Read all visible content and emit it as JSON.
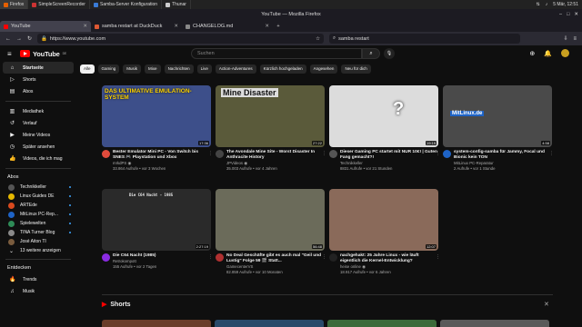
{
  "taskbar": {
    "tasks": [
      "Firefox",
      "SimpleScreenRecorder",
      "Samba-Server Konfiguration",
      "Thunar"
    ],
    "clock": "5 Mär, 12:51"
  },
  "window": {
    "title": "YouTube — Mozilla Firefox"
  },
  "tabs": [
    {
      "label": "YouTube",
      "active": true
    },
    {
      "label": "samba restart at DuckDuck",
      "active": false
    },
    {
      "label": "CHANGELOG.md",
      "active": false
    }
  ],
  "nav": {
    "url": "https://www.youtube.com",
    "search_value": "samba restart"
  },
  "yt": {
    "logo_text": "YouTube",
    "region": "DE",
    "search_placeholder": "Suchen",
    "sidebar_main": [
      {
        "label": "Startseite",
        "icon": "home-icon",
        "active": true
      },
      {
        "label": "Shorts",
        "icon": "shorts-icon"
      },
      {
        "label": "Abos",
        "icon": "subscriptions-icon"
      }
    ],
    "sidebar_you": [
      {
        "label": "Mediathek",
        "icon": "library-icon"
      },
      {
        "label": "Verlauf",
        "icon": "history-icon"
      },
      {
        "label": "Meine Videos",
        "icon": "my-videos-icon"
      },
      {
        "label": "Später ansehen",
        "icon": "watch-later-icon"
      },
      {
        "label": "Videos, die ich mag",
        "icon": "like-icon"
      }
    ],
    "abos_heading": "Abos",
    "abos": [
      {
        "label": "Technikkeller",
        "color": "#555",
        "dot": true
      },
      {
        "label": "Linux Guides DE",
        "color": "#e6b800",
        "dot": true
      },
      {
        "label": "ARTEde",
        "color": "#d94a1e",
        "dot": true
      },
      {
        "label": "MitLinux PC-Rep...",
        "color": "#1e63c6",
        "dot": true
      },
      {
        "label": "Spielewelten",
        "color": "#2e8b57",
        "dot": true
      },
      {
        "label": "TINA Turner Blog",
        "color": "#8a8a8a",
        "dot": true
      },
      {
        "label": "José Aiton TI",
        "color": "#7a5c3e",
        "dot": false
      },
      {
        "label": "13 weitere anzeigen",
        "icon": "chevron-down-icon"
      }
    ],
    "entdecken_heading": "Entdecken",
    "entdecken": [
      {
        "label": "Trends",
        "icon": "trending-icon"
      },
      {
        "label": "Musik",
        "icon": "music-icon"
      }
    ],
    "chips": [
      "Alle",
      "Gaming",
      "Musik",
      "Mixe",
      "Nachrichten",
      "Live",
      "Action-Adventures",
      "Kürzlich hochgeladen",
      "Angesehen",
      "Neu für dich"
    ],
    "shorts_label": "Shorts"
  },
  "videos": [
    {
      "title": "Bester Emulator Mini PC - Von Switch bis SNES 🎮 Playstation und Xbox",
      "channel": "mrkdPS ◉",
      "meta": "33.864 Aufrufe • vor 3 Wochen",
      "duration": "17:36",
      "thumb_text": "DAS ULTIMATIVE EMULATION-SYSTEM",
      "bg": "#3d4f8a",
      "av": "#e04b3c"
    },
    {
      "title": "The Avondale Mine Site - Worst Disaster In Anthracite History",
      "channel": "JPVideos ◉",
      "meta": "35.003 Aufrufe • vor 4 Jahren",
      "duration": "27:22",
      "thumb_text": "Mine Disaster",
      "bg": "#5a5a3a",
      "av": "#444"
    },
    {
      "title": "Dieser Gaming PC startet mit NUR 10€! | Guten Fang gemacht?!",
      "channel": "Technikkeller",
      "meta": "8831 Aufrufe • vor 21 Stunden",
      "duration": "19:19",
      "thumb_text": "?",
      "bg": "#dcdcdc",
      "av": "#555"
    },
    {
      "title": "system-config-samba für Jammy, Focal und Bionic kein TON",
      "channel": "MitLinux PC-Reparatur",
      "meta": "2 Aufrufe • vor 1 Stunde",
      "duration": "4:58",
      "thumb_text": "MitLinux.de",
      "bg": "#4a4a4a",
      "av": "#1e63c6"
    },
    {
      "title": "Die C64 Nacht (1985)",
      "channel": "Retrokompott",
      "meta": "155 Aufrufe • vor 2 Tagen",
      "duration": "2:27:19",
      "thumb_text": "Die C64 Nacht - 1985",
      "bg": "#2a2a2a",
      "av": "#8a2be2"
    },
    {
      "title": "No Deal Geschäfte gibt es auch mal \"Geil und Lustig\" Folge 59 🎬 Statt...",
      "channel": "GamecenterVS",
      "meta": "82.859 Aufrufe • vor 10 Monaten",
      "duration": "56:48",
      "thumb_text": "",
      "bg": "#6b6b5a",
      "av": "#b03030"
    },
    {
      "title": "nachgehakt: 25 Jahre Linux - wie läuft eigentlich die Kernel-Entwicklung?",
      "channel": "heise online ◉",
      "meta": "18.917 Aufrufe • vor 6 Jahren",
      "duration": "12:07",
      "thumb_text": "",
      "bg": "#8a6a5a",
      "av": "#222"
    }
  ]
}
